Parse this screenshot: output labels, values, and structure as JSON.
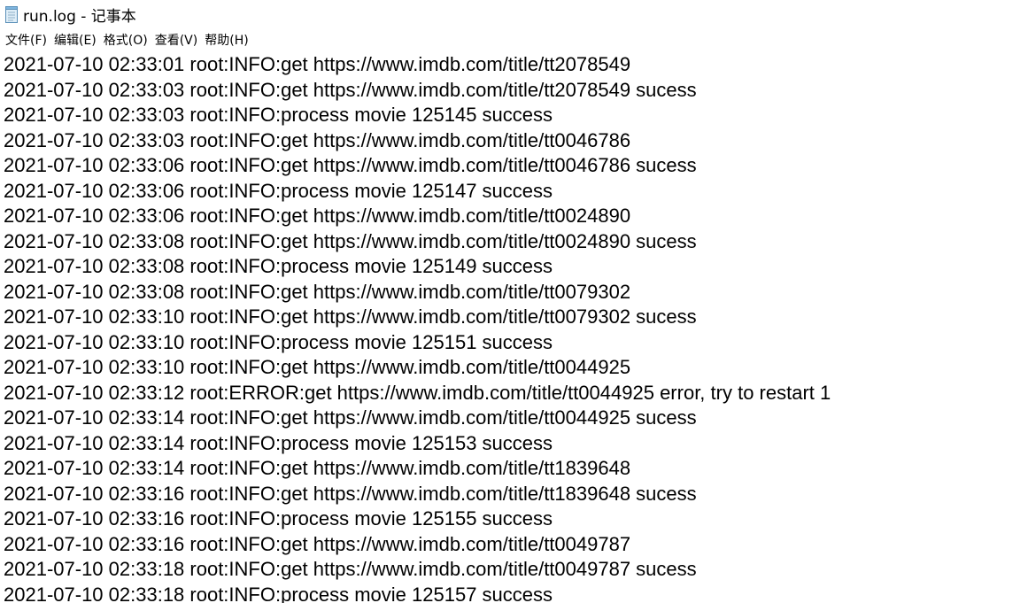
{
  "window": {
    "title": "run.log - 记事本",
    "icon": "notepad-icon"
  },
  "menu": [
    {
      "label": "文件(F)"
    },
    {
      "label": "编辑(E)"
    },
    {
      "label": "格式(O)"
    },
    {
      "label": "查看(V)"
    },
    {
      "label": "帮助(H)"
    }
  ],
  "lines": [
    "2021-07-10 02:33:01 root:INFO:get https://www.imdb.com/title/tt2078549",
    "2021-07-10 02:33:03 root:INFO:get https://www.imdb.com/title/tt2078549 sucess",
    "2021-07-10 02:33:03 root:INFO:process movie 125145 success",
    "2021-07-10 02:33:03 root:INFO:get https://www.imdb.com/title/tt0046786",
    "2021-07-10 02:33:06 root:INFO:get https://www.imdb.com/title/tt0046786 sucess",
    "2021-07-10 02:33:06 root:INFO:process movie 125147 success",
    "2021-07-10 02:33:06 root:INFO:get https://www.imdb.com/title/tt0024890",
    "2021-07-10 02:33:08 root:INFO:get https://www.imdb.com/title/tt0024890 sucess",
    "2021-07-10 02:33:08 root:INFO:process movie 125149 success",
    "2021-07-10 02:33:08 root:INFO:get https://www.imdb.com/title/tt0079302",
    "2021-07-10 02:33:10 root:INFO:get https://www.imdb.com/title/tt0079302 sucess",
    "2021-07-10 02:33:10 root:INFO:process movie 125151 success",
    "2021-07-10 02:33:10 root:INFO:get https://www.imdb.com/title/tt0044925",
    "2021-07-10 02:33:12 root:ERROR:get https://www.imdb.com/title/tt0044925 error, try to restart 1",
    "2021-07-10 02:33:14 root:INFO:get https://www.imdb.com/title/tt0044925 sucess",
    "2021-07-10 02:33:14 root:INFO:process movie 125153 success",
    "2021-07-10 02:33:14 root:INFO:get https://www.imdb.com/title/tt1839648",
    "2021-07-10 02:33:16 root:INFO:get https://www.imdb.com/title/tt1839648 sucess",
    "2021-07-10 02:33:16 root:INFO:process movie 125155 success",
    "2021-07-10 02:33:16 root:INFO:get https://www.imdb.com/title/tt0049787",
    "2021-07-10 02:33:18 root:INFO:get https://www.imdb.com/title/tt0049787 sucess",
    "2021-07-10 02:33:18 root:INFO:process movie 125157 success"
  ]
}
